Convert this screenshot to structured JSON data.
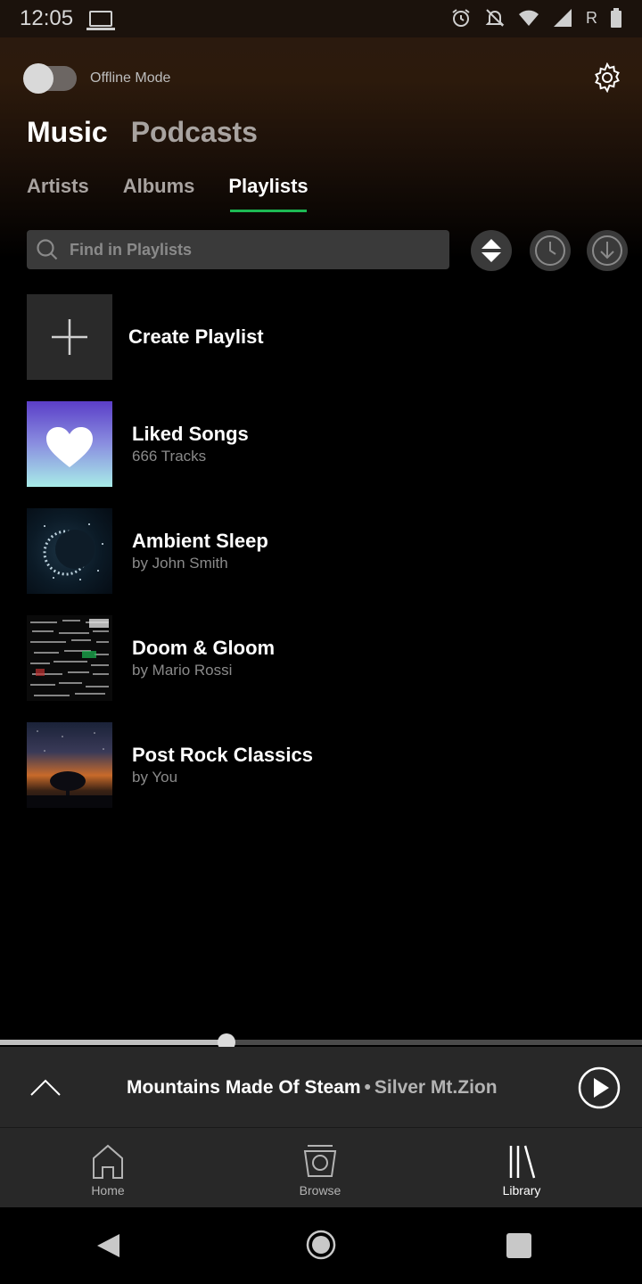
{
  "status_bar": {
    "time": "12:05",
    "carrier_letter": "R"
  },
  "offline": {
    "label": "Offline Mode",
    "enabled": false
  },
  "main_tabs": [
    {
      "label": "Music",
      "active": true
    },
    {
      "label": "Podcasts",
      "active": false
    }
  ],
  "sub_tabs": [
    {
      "label": "Artists",
      "active": false
    },
    {
      "label": "Albums",
      "active": false
    },
    {
      "label": "Playlists",
      "active": true
    }
  ],
  "search": {
    "placeholder": "Find in Playlists",
    "value": ""
  },
  "toolbar_icons": [
    "sort-icon",
    "recent-clock-icon",
    "download-icon"
  ],
  "create_playlist": {
    "label": "Create Playlist"
  },
  "playlists": [
    {
      "title": "Liked Songs",
      "subtitle": "666 Tracks",
      "art": "heart-gradient"
    },
    {
      "title": "Ambient Sleep",
      "subtitle": "by John Smith",
      "art": "crescent-moon-stars"
    },
    {
      "title": "Doom & Gloom",
      "subtitle": "by Mario Rossi",
      "art": "band-logo-collage"
    },
    {
      "title": "Post Rock Classics",
      "subtitle": "by You",
      "art": "tree-night-sky"
    }
  ],
  "now_playing": {
    "track": "Mountains Made Of Steam",
    "separator": "•",
    "artist": "Silver Mt.Zion",
    "progress": 0.353
  },
  "bottom_nav": [
    {
      "label": "Home",
      "icon": "home-icon",
      "active": false
    },
    {
      "label": "Browse",
      "icon": "browse-icon",
      "active": false
    },
    {
      "label": "Library",
      "icon": "library-icon",
      "active": true
    }
  ],
  "colors": {
    "accent": "#1db954",
    "surface": "#282828",
    "muted_text": "#8a8a8a"
  }
}
